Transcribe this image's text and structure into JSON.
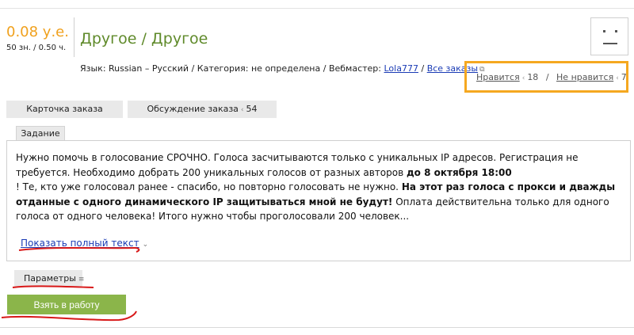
{
  "order": {
    "price": "0.08 у.е.",
    "price_sub": "50 зн. / 0.50 ч.",
    "title": "Другое / Другое"
  },
  "meta": {
    "language_label": "Язык:",
    "language_value": "Russian – Русский",
    "category_label": "Категория:",
    "category_value": "не определена",
    "webmaster_label": "Вебмастер:",
    "webmaster_link": "Lola777",
    "all_orders_link": "Все заказы"
  },
  "votes": {
    "like_label": "Нравится",
    "like_count": "18",
    "separator": "/",
    "dislike_label": "Не нравится",
    "dislike_count": "7"
  },
  "tabs": [
    {
      "label": "Карточка заказа"
    },
    {
      "label": "Обсуждение заказа",
      "count": "54"
    }
  ],
  "task": {
    "section_label": "Задание",
    "text_1": "Нужно помочь в голосование СРОЧНО. Голоса засчитываются только с уникальных IP адресов. Регистрация не требуется. Необходимо добрать 200 уникальных голосов от разных авторов ",
    "text_bold_1": "до 8 октября 18:00",
    "text_2": "! Те, кто уже голосовал ранее - спасибо, но повторно голосовать не нужно. ",
    "text_bold_2": "На этот раз голоса с прокси и дважды отданные с одного динамического IP защитываться мной не будут!",
    "text_3": " Оплата действительна только для одного голоса от одного человека! Итого нужно чтобы проголосовали 200 человек...",
    "show_full_label": "Показать полный текст"
  },
  "params": {
    "label": "Параметры"
  },
  "actions": {
    "take_label": "Взять в работу"
  },
  "colors": {
    "price": "#f0a11e",
    "title": "#5f8a2a",
    "link": "#1a3bb5",
    "vote_highlight": "#f5a820",
    "take_button": "#8bb54a",
    "scribble": "#d81818"
  }
}
